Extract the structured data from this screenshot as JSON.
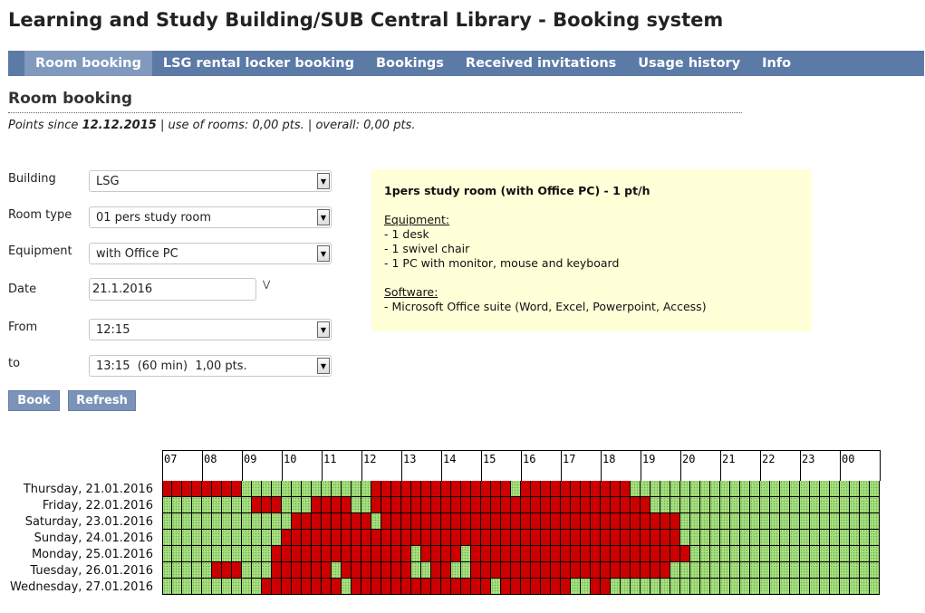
{
  "page_title": "Learning and Study Building/SUB Central Library - Booking system",
  "nav": [
    {
      "id": "room-booking",
      "label": "Room booking",
      "active": true
    },
    {
      "id": "lsg-rental-locker-booking",
      "label": "LSG rental locker booking"
    },
    {
      "id": "bookings",
      "label": "Bookings"
    },
    {
      "id": "received-invitations",
      "label": "Received invitations"
    },
    {
      "id": "usage-history",
      "label": "Usage history"
    },
    {
      "id": "info",
      "label": "Info"
    }
  ],
  "section_title": "Room booking",
  "points": {
    "prefix": "Points since ",
    "date": "12.12.2015",
    "suffix": " | use of rooms: 0,00 pts. | overall: 0,00 pts."
  },
  "form": {
    "building": {
      "label": "Building",
      "value": "LSG"
    },
    "room_type": {
      "label": "Room type",
      "value": "01 pers study room"
    },
    "equipment": {
      "label": "Equipment",
      "value": "with Office PC"
    },
    "date": {
      "label": "Date",
      "value": "21.1.2016"
    },
    "from": {
      "label": "From",
      "value": "12:15"
    },
    "to": {
      "label": "to",
      "value": "13:15  (60 min)  1,00 pts."
    }
  },
  "buttons": {
    "book": "Book",
    "refresh": "Refresh"
  },
  "info": {
    "title": "1pers study room (with Office PC) - 1 pt/h",
    "equipment_heading": "Equipment:",
    "equipment_items": [
      "- 1 desk",
      "- 1 swivel chair",
      "- 1 PC with monitor, mouse and keyboard"
    ],
    "software_heading": "Software:",
    "software_items": [
      "- Microsoft Office suite (Word, Excel, Powerpoint, Access)"
    ]
  },
  "schedule": {
    "hours": [
      "07",
      "08",
      "09",
      "10",
      "11",
      "12",
      "13",
      "14",
      "15",
      "16",
      "17",
      "18",
      "19",
      "20",
      "21",
      "22",
      "23",
      "00"
    ],
    "slot_minutes": 15,
    "colors": {
      "free": "#a6e07e",
      "busy": "#cc0000"
    },
    "days": [
      {
        "label": "Thursday, 21.01.2016",
        "busy": [
          [
            0,
            8
          ],
          [
            21,
            35
          ],
          [
            36,
            47
          ]
        ]
      },
      {
        "label": "Friday, 22.01.2016",
        "busy": [
          [
            9,
            12
          ],
          [
            15,
            19
          ],
          [
            21,
            49
          ]
        ]
      },
      {
        "label": "Saturday, 23.01.2016",
        "busy": [
          [
            13,
            21
          ],
          [
            22,
            52
          ]
        ]
      },
      {
        "label": "Sunday, 24.01.2016",
        "busy": [
          [
            12,
            52
          ]
        ]
      },
      {
        "label": "Monday, 25.01.2016",
        "busy": [
          [
            11,
            25
          ],
          [
            26,
            30
          ],
          [
            31,
            53
          ]
        ]
      },
      {
        "label": "Tuesday, 26.01.2016",
        "busy": [
          [
            5,
            8
          ],
          [
            11,
            17
          ],
          [
            18,
            25
          ],
          [
            27,
            29
          ],
          [
            31,
            51
          ]
        ]
      },
      {
        "label": "Wednesday, 27.01.2016",
        "busy": [
          [
            10,
            18
          ],
          [
            19,
            33
          ],
          [
            34,
            41
          ],
          [
            43,
            45
          ]
        ]
      }
    ]
  }
}
